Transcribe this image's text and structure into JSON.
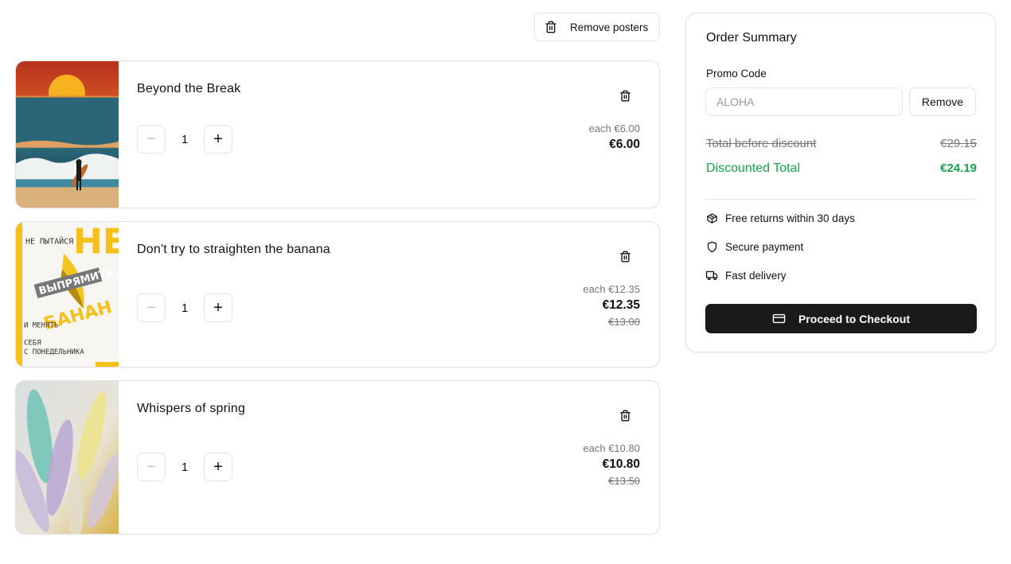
{
  "toolbar": {
    "remove_posters_label": "Remove posters"
  },
  "cart_items": [
    {
      "title": "Beyond the Break",
      "quantity": "1",
      "each_price": "each €6.00",
      "price": "€6.00",
      "old_price": ""
    },
    {
      "title": "Don't try to straighten the banana",
      "quantity": "1",
      "each_price": "each €12.35",
      "price": "€12.35",
      "old_price": "€13.00"
    },
    {
      "title": "Whispers of spring",
      "quantity": "1",
      "each_price": "each €10.80",
      "price": "€10.80",
      "old_price": "€13.50"
    }
  ],
  "poster2_text": [
    "НЕ ПЫТАЙСЯ",
    "ВЫПРЯМИТЬ",
    "БАНАН",
    "И МЕНЯТЬ",
    "СЕБЯ",
    "С ПОНЕДЕЛЬНИКА",
    "НЕ"
  ],
  "summary": {
    "title": "Order Summary",
    "promo_label": "Promo Code",
    "promo_value": "ALOHA",
    "promo_remove_label": "Remove",
    "total_before_label": "Total before discount",
    "total_before_value": "€29.15",
    "discounted_label": "Discounted Total",
    "discounted_value": "€24.19",
    "features": [
      "Free returns within 30 days",
      "Secure payment",
      "Fast delivery"
    ],
    "checkout_label": "Proceed to Checkout"
  },
  "colors": {
    "accent_green": "#16a34a",
    "checkout_bg": "#1a1a1a"
  },
  "icons": [
    "trash-icon",
    "minus-icon",
    "plus-icon",
    "package-icon",
    "shield-icon",
    "truck-icon",
    "credit-card-icon"
  ]
}
